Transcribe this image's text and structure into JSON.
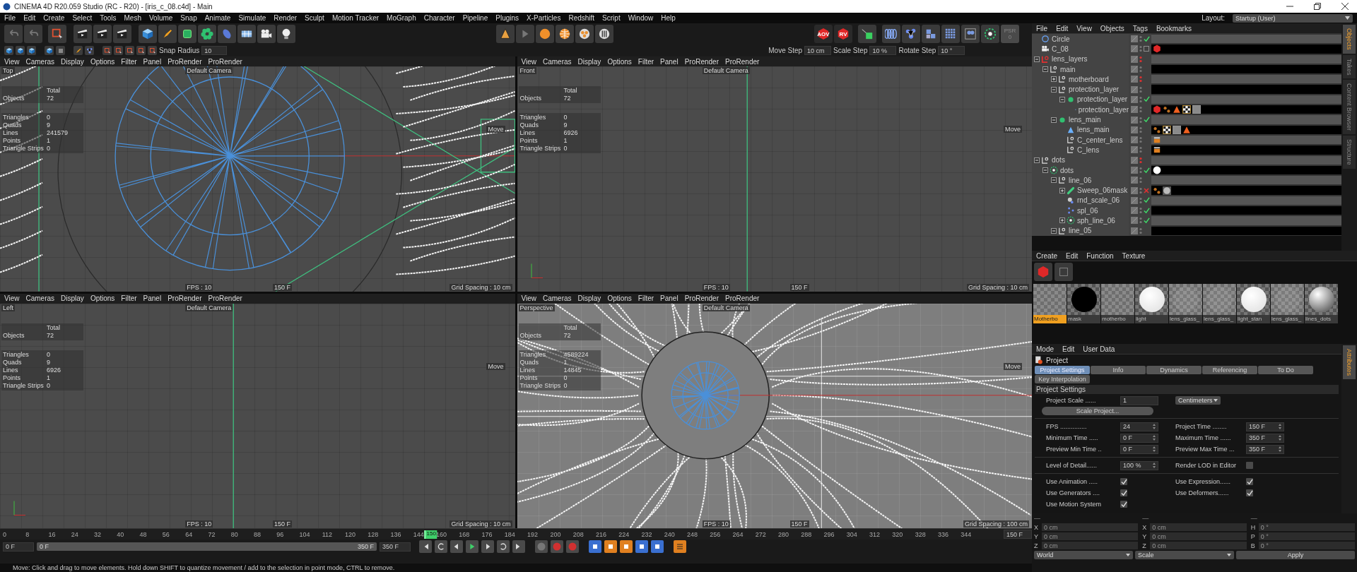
{
  "window": {
    "title": "CINEMA 4D R20.059 Studio (RC - R20) - [iris_c_08.c4d] - Main"
  },
  "menu": [
    "File",
    "Edit",
    "Create",
    "Select",
    "Tools",
    "Mesh",
    "Volume",
    "Snap",
    "Animate",
    "Simulate",
    "Render",
    "Sculpt",
    "Motion Tracker",
    "MoGraph",
    "Character",
    "Pipeline",
    "Plugins",
    "X-Particles",
    "Redshift",
    "Script",
    "Window",
    "Help"
  ],
  "layout": {
    "label": "Layout:",
    "value": "Startup (User)"
  },
  "toolbar": {
    "render_badges": [
      "AOV",
      "RV"
    ],
    "psr": {
      "label": "PSR",
      "value": "0"
    }
  },
  "snap": {
    "label": "Snap Radius",
    "value": "10"
  },
  "steps": [
    {
      "label": "Move Step",
      "value": "10 cm"
    },
    {
      "label": "Scale Step",
      "value": "10 %"
    },
    {
      "label": "Rotate Step",
      "value": "10 °"
    }
  ],
  "viewports": [
    {
      "kind": "top",
      "menu": [
        "View",
        "Cameras",
        "Display",
        "Options",
        "Filter",
        "Panel",
        "ProRender",
        "ProRender"
      ],
      "name": "Top",
      "camera": "Default Camera",
      "total": "Total",
      "objects": {
        "label": "Objects",
        "value": "72"
      },
      "stats": [
        {
          "label": "Triangles",
          "value": "0"
        },
        {
          "label": "Quads",
          "value": "9"
        },
        {
          "label": "Lines",
          "value": "241579"
        },
        {
          "label": "Points",
          "value": "1"
        },
        {
          "label": "Triangle Strips",
          "value": "0"
        }
      ],
      "move": "Move",
      "fps": "FPS : 10",
      "frame": "150 F",
      "grid": "Grid Spacing : 10 cm"
    },
    {
      "kind": "front",
      "menu": [
        "View",
        "Cameras",
        "Display",
        "Options",
        "Filter",
        "Panel",
        "ProRender",
        "ProRender"
      ],
      "name": "Front",
      "camera": "Default Camera",
      "total": "Total",
      "objects": {
        "label": "Objects",
        "value": "72"
      },
      "stats": [
        {
          "label": "Triangles",
          "value": "0"
        },
        {
          "label": "Quads",
          "value": "9"
        },
        {
          "label": "Lines",
          "value": "6926"
        },
        {
          "label": "Points",
          "value": "1"
        },
        {
          "label": "Triangle Strips",
          "value": "0"
        }
      ],
      "move": "Move",
      "fps": "FPS : 10",
      "frame": "150 F",
      "grid": "Grid Spacing : 10 cm"
    },
    {
      "kind": "left",
      "menu": [
        "View",
        "Cameras",
        "Display",
        "Options",
        "Filter",
        "Panel",
        "ProRender",
        "ProRender"
      ],
      "name": "Left",
      "camera": "Default Camera",
      "total": "Total",
      "objects": {
        "label": "Objects",
        "value": "72"
      },
      "stats": [
        {
          "label": "Triangles",
          "value": "0"
        },
        {
          "label": "Quads",
          "value": "9"
        },
        {
          "label": "Lines",
          "value": "6926"
        },
        {
          "label": "Points",
          "value": "1"
        },
        {
          "label": "Triangle Strips",
          "value": "0"
        }
      ],
      "move": "Move",
      "fps": "FPS : 10",
      "frame": "150 F",
      "grid": "Grid Spacing : 10 cm"
    },
    {
      "kind": "perspective",
      "menu": [
        "View",
        "Cameras",
        "Display",
        "Options",
        "Filter",
        "Panel",
        "ProRender",
        "ProRender"
      ],
      "name": "Perspective",
      "camera": "Default Camera",
      "total": "Total",
      "objects": {
        "label": "Objects",
        "value": "72"
      },
      "stats": [
        {
          "label": "Triangles",
          "value": "4589224"
        },
        {
          "label": "Quads",
          "value": "1"
        },
        {
          "label": "Lines",
          "value": "14845"
        },
        {
          "label": "Points",
          "value": "0"
        },
        {
          "label": "Triangle Strips",
          "value": "0"
        }
      ],
      "move": "Move",
      "fps": "FPS : 10",
      "frame": "150 F",
      "grid": "Grid Spacing : 100 cm"
    }
  ],
  "object_manager": {
    "menu": [
      "File",
      "Edit",
      "View",
      "Objects",
      "Tags",
      "Bookmarks"
    ],
    "objects": [
      {
        "name": "Circle",
        "kind": "circle",
        "editor_hidden": false,
        "enabled": true
      },
      {
        "name": "C_08",
        "kind": "camera",
        "editor_hidden": false,
        "tags": [
          {
            "kind": "red-hex"
          }
        ]
      },
      {
        "name": "lens_layers",
        "kind": "layer",
        "expanded": true,
        "editor_hidden": true,
        "children": [
          {
            "name": "main",
            "kind": "null",
            "expanded": true,
            "editor_hidden": false,
            "children": [
              {
                "name": "motherboard",
                "kind": "null",
                "expanded": false,
                "editor_hidden": true
              },
              {
                "name": "protection_layer",
                "kind": "null",
                "expanded": true,
                "editor_hidden": false,
                "children": [
                  {
                    "name": "protection_layer",
                    "kind": "generator",
                    "expanded": true,
                    "editor_hidden": false,
                    "enabled": true,
                    "children": [
                      {
                        "name": "protection_layer",
                        "kind": "cone",
                        "editor_hidden": false,
                        "tags": [
                          {
                            "kind": "red-hex"
                          },
                          {
                            "kind": "orange-dots"
                          },
                          {
                            "kind": "orange-cone"
                          },
                          {
                            "kind": "checker"
                          },
                          {
                            "kind": "noise"
                          }
                        ]
                      }
                    ]
                  }
                ]
              },
              {
                "name": "lens_main",
                "kind": "generator",
                "expanded": true,
                "editor_hidden": false,
                "enabled": true,
                "children": [
                  {
                    "name": "lens_main",
                    "kind": "cone",
                    "editor_hidden": false,
                    "tags": [
                      {
                        "kind": "orange-dots"
                      },
                      {
                        "kind": "checker"
                      },
                      {
                        "kind": "noise"
                      },
                      {
                        "kind": "orange-cone"
                      }
                    ]
                  },
                  {
                    "name": "C_center_lens",
                    "kind": "null",
                    "editor_hidden": false,
                    "tags": [
                      {
                        "kind": "clapper"
                      }
                    ]
                  },
                  {
                    "name": "C_lens",
                    "kind": "null",
                    "editor_hidden": false,
                    "tags": [
                      {
                        "kind": "clapper"
                      }
                    ]
                  }
                ]
              }
            ]
          }
        ]
      },
      {
        "name": "dots",
        "kind": "null",
        "expanded": true,
        "editor_hidden": true,
        "children": [
          {
            "name": "dots",
            "kind": "cloner",
            "expanded": true,
            "editor_hidden": false,
            "enabled": true,
            "tags": [
              {
                "kind": "white-sphere"
              }
            ],
            "children": [
              {
                "name": "line_06",
                "kind": "null",
                "expanded": true,
                "editor_hidden": false,
                "children": [
                  {
                    "name": "Sweep_06mask",
                    "kind": "sweep",
                    "expanded": false,
                    "editor_hidden": false,
                    "enabled": false,
                    "tags": [
                      {
                        "kind": "orange-dots"
                      },
                      {
                        "kind": "gray-sphere"
                      }
                    ]
                  },
                  {
                    "name": "rnd_scale_06",
                    "kind": "effector",
                    "editor_hidden": false,
                    "enabled": true
                  },
                  {
                    "name": "spl_06",
                    "kind": "spline",
                    "editor_hidden": false,
                    "enabled": true
                  },
                  {
                    "name": "sph_line_06",
                    "kind": "cloner",
                    "expanded": false,
                    "editor_hidden": false,
                    "enabled": true
                  }
                ]
              },
              {
                "name": "line_05",
                "kind": "null",
                "expanded": true,
                "editor_hidden": false
              }
            ]
          }
        ]
      }
    ]
  },
  "side_tabs": [
    {
      "label": "Objects",
      "selected": true
    },
    {
      "label": "Takes",
      "selected": false
    },
    {
      "label": "Content Browser",
      "selected": false
    },
    {
      "label": "Structure",
      "selected": false
    }
  ],
  "material_manager": {
    "menu": [
      "Create",
      "Edit",
      "Function",
      "Texture"
    ],
    "materials": [
      {
        "name": "Motherbo",
        "kind": "checker",
        "selected": true
      },
      {
        "name": "mask",
        "kind": "black-sphere",
        "selected": false
      },
      {
        "name": "motherbo",
        "kind": "checker",
        "selected": false
      },
      {
        "name": "light",
        "kind": "white-sphere",
        "selected": false
      },
      {
        "name": "lens_glass_",
        "kind": "glass",
        "selected": false
      },
      {
        "name": "lens_glass_",
        "kind": "glass",
        "selected": false
      },
      {
        "name": "light_stan",
        "kind": "white-sphere",
        "selected": false
      },
      {
        "name": "lens_glass_",
        "kind": "glass",
        "selected": false
      },
      {
        "name": "lines_dots",
        "kind": "gray-sphere",
        "selected": false
      }
    ]
  },
  "attributes": {
    "menu": [
      "Mode",
      "Edit",
      "User Data"
    ],
    "title": "Project",
    "tabs": [
      {
        "label": "Project Settings",
        "selected": true
      },
      {
        "label": "Info",
        "selected": false
      },
      {
        "label": "Dynamics",
        "selected": false
      },
      {
        "label": "Referencing",
        "selected": false
      },
      {
        "label": "To Do",
        "selected": false
      },
      {
        "label": "Key Interpolation",
        "selected": false
      }
    ],
    "section": "Project Settings",
    "scale": {
      "label": "Project Scale ......",
      "value": "1",
      "unit": "Centimeters",
      "button": "Scale Project..."
    },
    "groups": [
      [
        [
          {
            "kind": "number",
            "label": "FPS ...............",
            "value": "24"
          },
          {
            "kind": "number",
            "label": "Project Time ........",
            "value": "150 F"
          }
        ],
        [
          {
            "kind": "number",
            "label": "Minimum Time .....",
            "value": "0 F"
          },
          {
            "kind": "number",
            "label": "Maximum Time ......",
            "value": "350 F"
          }
        ],
        [
          {
            "kind": "number",
            "label": "Preview Min Time ..",
            "value": "0 F"
          },
          {
            "kind": "number",
            "label": "Preview Max Time ...",
            "value": "350 F"
          }
        ]
      ],
      [
        [
          {
            "kind": "number",
            "label": "Level of Detail......",
            "value": "100 %"
          },
          {
            "kind": "checkbox",
            "label": "Render LOD in Editor",
            "checked": false
          }
        ]
      ],
      [
        [
          {
            "kind": "checkbox",
            "label": "Use Animation .....",
            "checked": true
          },
          {
            "kind": "checkbox",
            "label": "Use Expression......",
            "checked": true
          }
        ],
        [
          {
            "kind": "checkbox",
            "label": "Use Generators ....",
            "checked": true
          },
          {
            "kind": "checkbox",
            "label": "Use Deformers......",
            "checked": true
          }
        ],
        [
          {
            "kind": "checkbox",
            "label": "Use Motion System",
            "checked": true
          }
        ]
      ]
    ]
  },
  "attribute_side_tabs": [
    {
      "label": "Attributes",
      "selected": true
    }
  ],
  "timeline": {
    "ruler": [
      "0",
      "8",
      "16",
      "24",
      "32",
      "40",
      "48",
      "56",
      "64",
      "72",
      "80",
      "88",
      "96",
      "104",
      "112",
      "120",
      "128",
      "136",
      "144",
      "160",
      "168",
      "176",
      "184",
      "192",
      "200",
      "208",
      "216",
      "224",
      "232",
      "240",
      "248",
      "256",
      "264",
      "272",
      "280",
      "288",
      "296",
      "304",
      "312",
      "320",
      "328",
      "336",
      "344"
    ],
    "playhead": {
      "label": "150",
      "level": 0.4286
    },
    "current_field": "150 F",
    "start_field": "0 F",
    "range": {
      "start": "0 F",
      "end": "350 F",
      "level": 1
    },
    "end_field": "350 F"
  },
  "coordinates": {
    "columns": [
      {
        "title": "—",
        "rows": [
          {
            "axis": "X",
            "value": "0 cm"
          },
          {
            "axis": "Y",
            "value": "0 cm"
          },
          {
            "axis": "Z",
            "value": "0 cm"
          }
        ]
      },
      {
        "title": "—",
        "rows": [
          {
            "axis": "X",
            "value": "0 cm"
          },
          {
            "axis": "Y",
            "value": "0 cm"
          },
          {
            "axis": "Z",
            "value": "0 cm"
          }
        ]
      },
      {
        "title": "—",
        "rows": [
          {
            "axis": "H",
            "value": "0 °"
          },
          {
            "axis": "P",
            "value": "0 °"
          },
          {
            "axis": "B",
            "value": "0 °"
          }
        ]
      }
    ],
    "dropdowns": [
      "World",
      "Scale"
    ],
    "button": "Apply"
  },
  "status_bar": "Move: Click and drag to move elements. Hold down SHIFT to quantize movement / add to the selection in point mode, CTRL to remove."
}
